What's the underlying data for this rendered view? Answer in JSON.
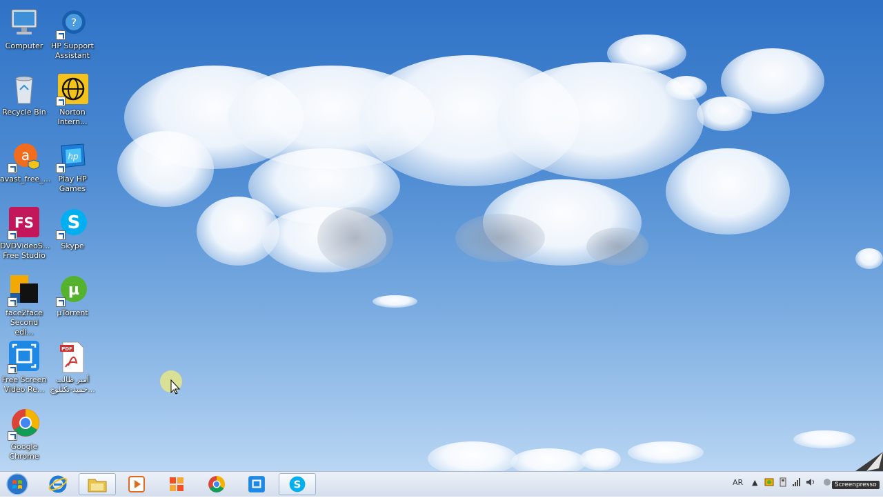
{
  "desktop_icons": [
    {
      "label": "Computer",
      "icon": "computer-icon"
    },
    {
      "label": "HP Support\nAssistant",
      "icon": "hp-support-icon"
    },
    {
      "label": "Recycle Bin",
      "icon": "recycle-bin-icon"
    },
    {
      "label": "Norton\nIntern...",
      "icon": "norton-icon"
    },
    {
      "label": "avast_free_...",
      "icon": "avast-icon"
    },
    {
      "label": "Play HP\nGames",
      "icon": "hp-games-icon"
    },
    {
      "label": "DVDVideoS...\nFree Studio",
      "icon": "fs-icon"
    },
    {
      "label": "Skype",
      "icon": "skype-icon"
    },
    {
      "label": "face2face\nSecond edi...",
      "icon": "face2face-icon"
    },
    {
      "label": "µTorrent",
      "icon": "utorrent-icon"
    },
    {
      "label": "Free Screen\nVideo Re...",
      "icon": "screen-recorder-icon"
    },
    {
      "label": "أمير طالب\n...حميد-تكنلوج",
      "icon": "pdf-icon"
    },
    {
      "label": "Google\nChrome",
      "icon": "chrome-icon"
    }
  ],
  "taskbar": {
    "pinned": [
      "internet-explorer-icon",
      "file-explorer-icon",
      "media-player-icon",
      "office-icon",
      "chrome-icon",
      "screen-recorder-icon",
      "skype-icon"
    ]
  },
  "tray": {
    "language": "AR",
    "watermark": "Screenpresso"
  }
}
